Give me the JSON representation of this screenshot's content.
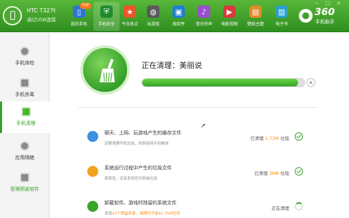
{
  "device": {
    "name": "HTC T327t",
    "connection": "通过USB连接"
  },
  "nav": [
    {
      "label": "我的手机",
      "badge": "TOP"
    },
    {
      "label": "手机安全"
    },
    {
      "label": "今日热点"
    },
    {
      "label": "玩游戏"
    },
    {
      "label": "找软件"
    },
    {
      "label": "音乐铃声"
    },
    {
      "label": "电影视频"
    },
    {
      "label": "壁纸主题"
    },
    {
      "label": "电子书"
    }
  ],
  "brand": {
    "number": "360",
    "sub": "手机助手"
  },
  "window_controls": [
    "−",
    "□",
    "×"
  ],
  "sidebar": [
    {
      "label": "手机体检"
    },
    {
      "label": "手机杀毒"
    },
    {
      "label": "手机清理"
    },
    {
      "label": "应用隔绝"
    },
    {
      "label": "管理预装软件"
    }
  ],
  "status": {
    "title": "正在清理：美丽说",
    "progress": 0.96,
    "cancel": "×"
  },
  "items": [
    {
      "title": "聊天、上网、玩游戏产生的缓存文件",
      "desc_pre": "定期清理手机垃圾，时刻保持手机畅快",
      "desc_hl": "",
      "desc_post": "",
      "status_pre": "已清理 ",
      "status_hl": "1.73M",
      "status_post": " 垃圾",
      "state": "done"
    },
    {
      "title": "系统运行过程中产生的垃圾文件",
      "desc_pre": "恭喜您，没有发现任何系统垃圾",
      "desc_hl": "",
      "desc_post": "",
      "status_pre": "已清理 ",
      "status_hl": "3MB",
      "status_post": " 垃圾",
      "state": "done"
    },
    {
      "title": "卸载软件、游戏时残留的系统文件",
      "desc_pre": "发现",
      "desc_hl": "15个残留目录，清理可节省41.75M空间",
      "desc_post": "",
      "status_pre": "正在清理",
      "status_hl": "",
      "status_post": "",
      "state": "running"
    }
  ],
  "colors": {
    "brand_green": "#36a02a",
    "highlight": "#ff8a00"
  }
}
